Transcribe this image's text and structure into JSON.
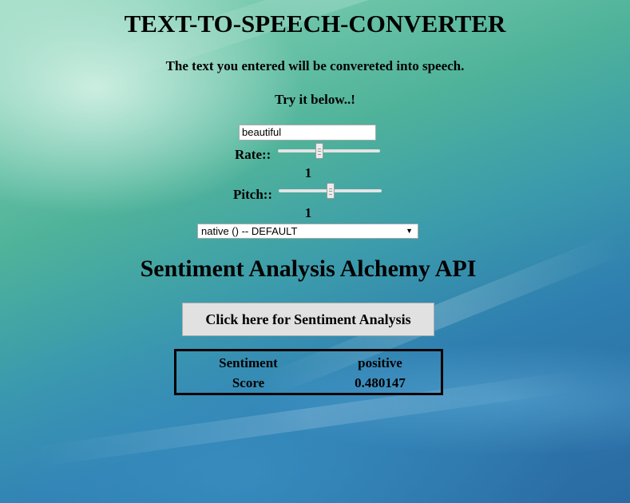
{
  "header": {
    "title": "TEXT-TO-SPEECH-CONVERTER",
    "intro": "The text you entered will be convereted into speech.",
    "prompt": "Try it below..!"
  },
  "tts": {
    "text_value": "beautiful",
    "rate_label": "Rate::",
    "rate_value": "1",
    "rate_fraction": 0.4,
    "pitch_label": "Pitch::",
    "pitch_value": "1",
    "pitch_fraction": 0.5,
    "voice_selected": "native () -- DEFAULT"
  },
  "sentiment": {
    "heading": "Sentiment Analysis Alchemy API",
    "button_label": "Click here for Sentiment Analysis",
    "rows": [
      {
        "label": "Sentiment",
        "value": "positive"
      },
      {
        "label": "Score",
        "value": "0.480147"
      }
    ]
  }
}
